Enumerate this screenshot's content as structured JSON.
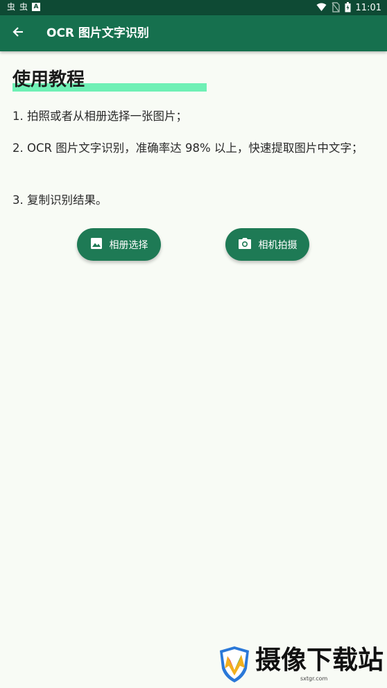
{
  "status_bar": {
    "time": "11:01",
    "notification_icons": [
      "虫",
      "虫"
    ],
    "notification_badge": "A",
    "icons": [
      "wifi-icon",
      "no-sim-icon",
      "battery-icon"
    ]
  },
  "app_bar": {
    "title": "OCR 图片文字识别",
    "back_icon": "arrow-back-icon"
  },
  "tutorial": {
    "heading": "使用教程",
    "steps": [
      "1. 拍照或者从相册选择一张图片；",
      "2. OCR 图片文字识别，准确率达 98% 以上，快速提取图片中文字；",
      "3. 复制识别结果。"
    ]
  },
  "actions": {
    "gallery": {
      "label": "相册选择",
      "icon": "image-icon"
    },
    "camera": {
      "label": "相机拍摄",
      "icon": "camera-icon"
    }
  },
  "watermark": {
    "text": "摄像下载站",
    "url": "sxtgr.com"
  },
  "colors": {
    "status_bar": "#0e4a34",
    "app_bar": "#16704e",
    "button": "#1e7a55",
    "highlight": "#6ff0b5",
    "background": "#f8fbf5"
  }
}
